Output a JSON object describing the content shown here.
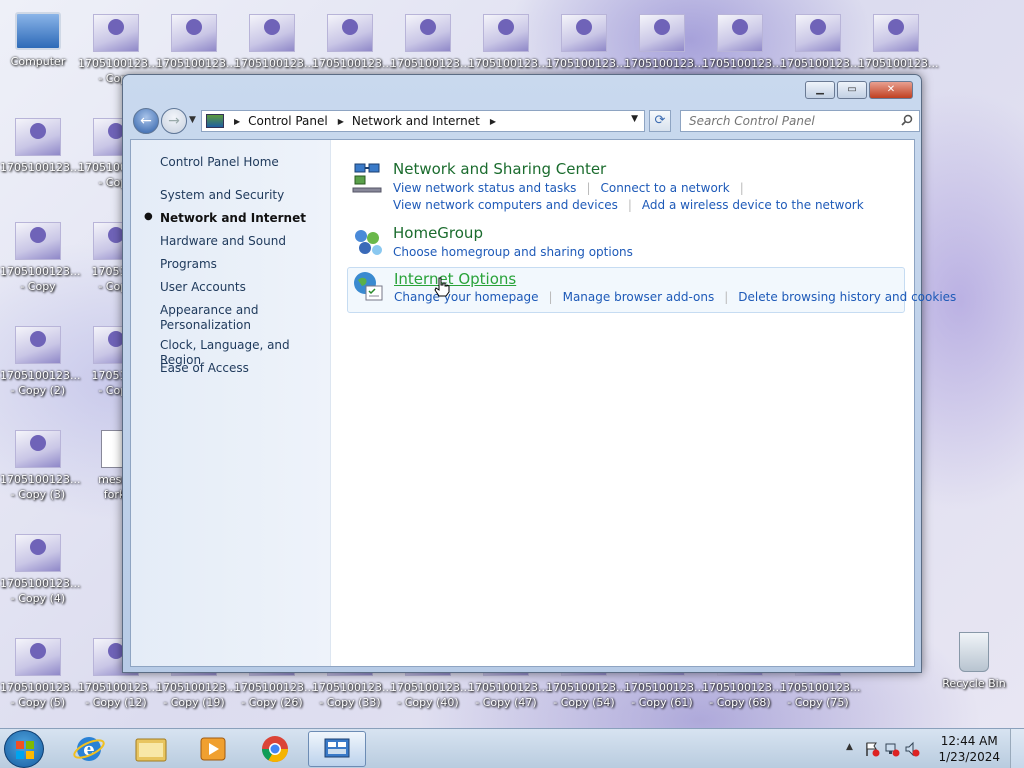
{
  "desktop": {
    "row1": [
      {
        "label1": "Computer",
        "label2": "",
        "kind": "computer"
      },
      {
        "label1": "1705100123...",
        "label2": "- Copy",
        "kind": "image"
      },
      {
        "label1": "1705100123...",
        "label2": "",
        "kind": "image"
      },
      {
        "label1": "1705100123...",
        "label2": "",
        "kind": "image"
      },
      {
        "label1": "1705100123...",
        "label2": "",
        "kind": "image"
      },
      {
        "label1": "1705100123...",
        "label2": "",
        "kind": "image"
      },
      {
        "label1": "1705100123...",
        "label2": "",
        "kind": "image"
      },
      {
        "label1": "1705100123...",
        "label2": "",
        "kind": "image"
      },
      {
        "label1": "1705100123...",
        "label2": "",
        "kind": "image"
      },
      {
        "label1": "1705100123...",
        "label2": "",
        "kind": "image"
      },
      {
        "label1": "1705100123...",
        "label2": "",
        "kind": "image"
      },
      {
        "label1": "1705100123...",
        "label2": "",
        "kind": "image"
      }
    ],
    "left_col": [
      {
        "label1": "1705100123...",
        "label2": ""
      },
      {
        "label1": "1705100123...",
        "label2": "- Copy"
      },
      {
        "label1": "1705100123...",
        "label2": "- Copy (2)"
      },
      {
        "label1": "1705100123...",
        "label2": "- Copy (3)"
      },
      {
        "label1": "1705100123...",
        "label2": "- Copy (4)"
      },
      {
        "label1": "1705100123...",
        "label2": "- Copy (5)"
      }
    ],
    "col2": [
      {
        "label1": "1705100123...",
        "label2": "- Copy"
      },
      {
        "label1": "1705100",
        "label2": "- Copy"
      },
      {
        "label1": "1705100",
        "label2": "- Copy"
      },
      {
        "label1": "messa",
        "label2": "forki"
      }
    ],
    "bottom_row": [
      {
        "label1": "1705100123...",
        "label2": "- Copy (12)"
      },
      {
        "label1": "1705100123...",
        "label2": "- Copy (19)"
      },
      {
        "label1": "1705100123...",
        "label2": "- Copy (26)"
      },
      {
        "label1": "1705100123...",
        "label2": "- Copy (33)"
      },
      {
        "label1": "1705100123...",
        "label2": "- Copy (40)"
      },
      {
        "label1": "1705100123...",
        "label2": "- Copy (47)"
      },
      {
        "label1": "1705100123...",
        "label2": "- Copy (54)"
      },
      {
        "label1": "1705100123...",
        "label2": "- Copy (61)"
      },
      {
        "label1": "1705100123...",
        "label2": "- Copy (68)"
      },
      {
        "label1": "1705100123...",
        "label2": "- Copy (75)"
      }
    ],
    "recycle_bin": "Recycle Bin"
  },
  "window": {
    "controls": {
      "minimize": "▁",
      "maximize": "▭",
      "close": "✕"
    }
  },
  "nav": {
    "breadcrumb": [
      "Control Panel",
      "Network and Internet"
    ],
    "search_placeholder": "Search Control Panel"
  },
  "sidebar": {
    "home": "Control Panel Home",
    "items": [
      "System and Security",
      "Network and Internet",
      "Hardware and Sound",
      "Programs",
      "User Accounts",
      "Appearance and",
      "Personalization",
      "Clock, Language, and Region",
      "Ease of Access"
    ],
    "active_index": 1
  },
  "categories": {
    "network_sharing": {
      "title": "Network and Sharing Center",
      "links_row1": [
        "View network status and tasks",
        "Connect to a network"
      ],
      "links_row2": [
        "View network computers and devices",
        "Add a wireless device to the network"
      ]
    },
    "homegroup": {
      "title": "HomeGroup",
      "links_row1": [
        "Choose homegroup and sharing options"
      ]
    },
    "internet_options": {
      "title": "Internet Options",
      "links_row1": [
        "Change your homepage",
        "Manage browser add-ons",
        "Delete browsing history and cookies"
      ]
    }
  },
  "taskbar": {
    "clock_time": "12:44 AM",
    "clock_date": "1/23/2024",
    "tray_arrow": "▲"
  }
}
